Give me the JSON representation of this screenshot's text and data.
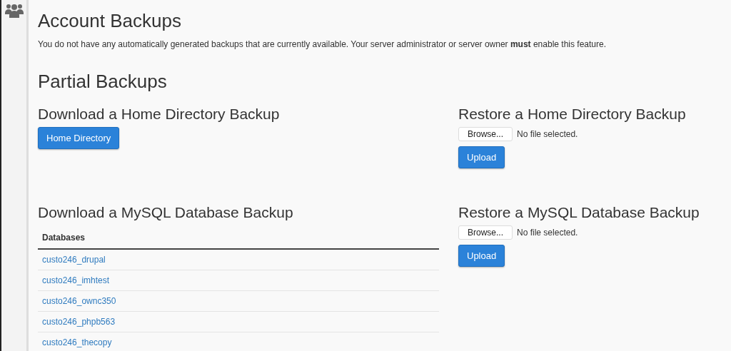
{
  "title": "Account Backups",
  "notice": "You do not have any automatically generated backups that are currently available. Your server administrator or server owner **must** enable this feature.",
  "partial": {
    "title": "Partial Backups",
    "sections": [
      {
        "kind": "download",
        "title": "Download a Home Directory Backup",
        "button": "Home Directory"
      },
      {
        "kind": "restore",
        "title": "Restore a Home Directory Backup",
        "browse": "Browse...",
        "file_status": "No file selected.",
        "button": "Upload"
      },
      {
        "kind": "table",
        "title": "Download a MySQL Database Backup",
        "column": "Databases",
        "rows": [
          "custo246_drupal",
          "custo246_imhtest",
          "custo246_ownc350",
          "custo246_phpb563",
          "custo246_thecopy"
        ]
      },
      {
        "kind": "restore",
        "title": "Restore a MySQL Database Backup",
        "browse": "Browse...",
        "file_status": "No file selected.",
        "button": "Upload"
      }
    ]
  }
}
